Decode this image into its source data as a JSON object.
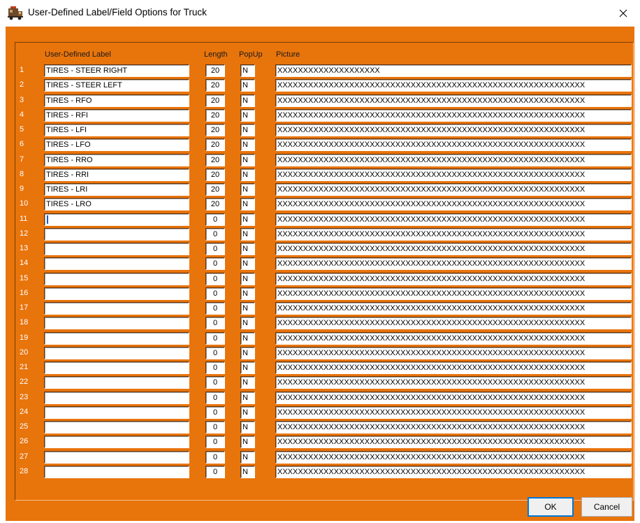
{
  "window": {
    "title": "User-Defined Label/Field Options for Truck",
    "icon": "truck-app-icon",
    "close_icon": "close-icon"
  },
  "columns": {
    "label": "User-Defined Label",
    "length": "Length",
    "popup": "PopUp",
    "picture": "Picture"
  },
  "rows": [
    {
      "num": "1",
      "label": "TIRES - STEER RIGHT",
      "length": "20",
      "popup": "N",
      "picture": "XXXXXXXXXXXXXXXXXXXX"
    },
    {
      "num": "2",
      "label": "TIRES - STEER LEFT",
      "length": "20",
      "popup": "N",
      "picture": "XXXXXXXXXXXXXXXXXXXXXXXXXXXXXXXXXXXXXXXXXXXXXXXXXXXXXXXXXXXX"
    },
    {
      "num": "3",
      "label": "TIRES - RFO",
      "length": "20",
      "popup": "N",
      "picture": "XXXXXXXXXXXXXXXXXXXXXXXXXXXXXXXXXXXXXXXXXXXXXXXXXXXXXXXXXXXX"
    },
    {
      "num": "4",
      "label": "TIRES - RFI",
      "length": "20",
      "popup": "N",
      "picture": "XXXXXXXXXXXXXXXXXXXXXXXXXXXXXXXXXXXXXXXXXXXXXXXXXXXXXXXXXXXX"
    },
    {
      "num": "5",
      "label": "TIRES - LFI",
      "length": "20",
      "popup": "N",
      "picture": "XXXXXXXXXXXXXXXXXXXXXXXXXXXXXXXXXXXXXXXXXXXXXXXXXXXXXXXXXXXX"
    },
    {
      "num": "6",
      "label": "TIRES - LFO",
      "length": "20",
      "popup": "N",
      "picture": "XXXXXXXXXXXXXXXXXXXXXXXXXXXXXXXXXXXXXXXXXXXXXXXXXXXXXXXXXXXX"
    },
    {
      "num": "7",
      "label": "TIRES - RRO",
      "length": "20",
      "popup": "N",
      "picture": "XXXXXXXXXXXXXXXXXXXXXXXXXXXXXXXXXXXXXXXXXXXXXXXXXXXXXXXXXXXX"
    },
    {
      "num": "8",
      "label": "TIRES - RRI",
      "length": "20",
      "popup": "N",
      "picture": "XXXXXXXXXXXXXXXXXXXXXXXXXXXXXXXXXXXXXXXXXXXXXXXXXXXXXXXXXXXX"
    },
    {
      "num": "9",
      "label": "TIRES - LRI",
      "length": "20",
      "popup": "N",
      "picture": "XXXXXXXXXXXXXXXXXXXXXXXXXXXXXXXXXXXXXXXXXXXXXXXXXXXXXXXXXXXX"
    },
    {
      "num": "10",
      "label": "TIRES - LRO",
      "length": "20",
      "popup": "N",
      "picture": "XXXXXXXXXXXXXXXXXXXXXXXXXXXXXXXXXXXXXXXXXXXXXXXXXXXXXXXXXXXX"
    },
    {
      "num": "11",
      "label": "",
      "length": "0",
      "popup": "N",
      "picture": "XXXXXXXXXXXXXXXXXXXXXXXXXXXXXXXXXXXXXXXXXXXXXXXXXXXXXXXXXXXX",
      "focused": true
    },
    {
      "num": "12",
      "label": "",
      "length": "0",
      "popup": "N",
      "picture": "XXXXXXXXXXXXXXXXXXXXXXXXXXXXXXXXXXXXXXXXXXXXXXXXXXXXXXXXXXXX"
    },
    {
      "num": "13",
      "label": "",
      "length": "0",
      "popup": "N",
      "picture": "XXXXXXXXXXXXXXXXXXXXXXXXXXXXXXXXXXXXXXXXXXXXXXXXXXXXXXXXXXXX"
    },
    {
      "num": "14",
      "label": "",
      "length": "0",
      "popup": "N",
      "picture": "XXXXXXXXXXXXXXXXXXXXXXXXXXXXXXXXXXXXXXXXXXXXXXXXXXXXXXXXXXXX"
    },
    {
      "num": "15",
      "label": "",
      "length": "0",
      "popup": "N",
      "picture": "XXXXXXXXXXXXXXXXXXXXXXXXXXXXXXXXXXXXXXXXXXXXXXXXXXXXXXXXXXXX"
    },
    {
      "num": "16",
      "label": "",
      "length": "0",
      "popup": "N",
      "picture": "XXXXXXXXXXXXXXXXXXXXXXXXXXXXXXXXXXXXXXXXXXXXXXXXXXXXXXXXXXXX"
    },
    {
      "num": "17",
      "label": "",
      "length": "0",
      "popup": "N",
      "picture": "XXXXXXXXXXXXXXXXXXXXXXXXXXXXXXXXXXXXXXXXXXXXXXXXXXXXXXXXXXXX"
    },
    {
      "num": "18",
      "label": "",
      "length": "0",
      "popup": "N",
      "picture": "XXXXXXXXXXXXXXXXXXXXXXXXXXXXXXXXXXXXXXXXXXXXXXXXXXXXXXXXXXXX"
    },
    {
      "num": "19",
      "label": "",
      "length": "0",
      "popup": "N",
      "picture": "XXXXXXXXXXXXXXXXXXXXXXXXXXXXXXXXXXXXXXXXXXXXXXXXXXXXXXXXXXXX"
    },
    {
      "num": "20",
      "label": "",
      "length": "0",
      "popup": "N",
      "picture": "XXXXXXXXXXXXXXXXXXXXXXXXXXXXXXXXXXXXXXXXXXXXXXXXXXXXXXXXXXXX"
    },
    {
      "num": "21",
      "label": "",
      "length": "0",
      "popup": "N",
      "picture": "XXXXXXXXXXXXXXXXXXXXXXXXXXXXXXXXXXXXXXXXXXXXXXXXXXXXXXXXXXXX"
    },
    {
      "num": "22",
      "label": "",
      "length": "0",
      "popup": "N",
      "picture": "XXXXXXXXXXXXXXXXXXXXXXXXXXXXXXXXXXXXXXXXXXXXXXXXXXXXXXXXXXXX"
    },
    {
      "num": "23",
      "label": "",
      "length": "0",
      "popup": "N",
      "picture": "XXXXXXXXXXXXXXXXXXXXXXXXXXXXXXXXXXXXXXXXXXXXXXXXXXXXXXXXXXXX"
    },
    {
      "num": "24",
      "label": "",
      "length": "0",
      "popup": "N",
      "picture": "XXXXXXXXXXXXXXXXXXXXXXXXXXXXXXXXXXXXXXXXXXXXXXXXXXXXXXXXXXXX"
    },
    {
      "num": "25",
      "label": "",
      "length": "0",
      "popup": "N",
      "picture": "XXXXXXXXXXXXXXXXXXXXXXXXXXXXXXXXXXXXXXXXXXXXXXXXXXXXXXXXXXXX"
    },
    {
      "num": "26",
      "label": "",
      "length": "0",
      "popup": "N",
      "picture": "XXXXXXXXXXXXXXXXXXXXXXXXXXXXXXXXXXXXXXXXXXXXXXXXXXXXXXXXXXXX"
    },
    {
      "num": "27",
      "label": "",
      "length": "0",
      "popup": "N",
      "picture": "XXXXXXXXXXXXXXXXXXXXXXXXXXXXXXXXXXXXXXXXXXXXXXXXXXXXXXXXXXXX"
    },
    {
      "num": "28",
      "label": "",
      "length": "0",
      "popup": "N",
      "picture": "XXXXXXXXXXXXXXXXXXXXXXXXXXXXXXXXXXXXXXXXXXXXXXXXXXXXXXXXXXXX"
    }
  ],
  "buttons": {
    "ok": "OK",
    "cancel": "Cancel"
  },
  "colors": {
    "background": "#E8740C",
    "row_number_text": "#FFFFFF",
    "field_background": "#FFFFFF"
  }
}
